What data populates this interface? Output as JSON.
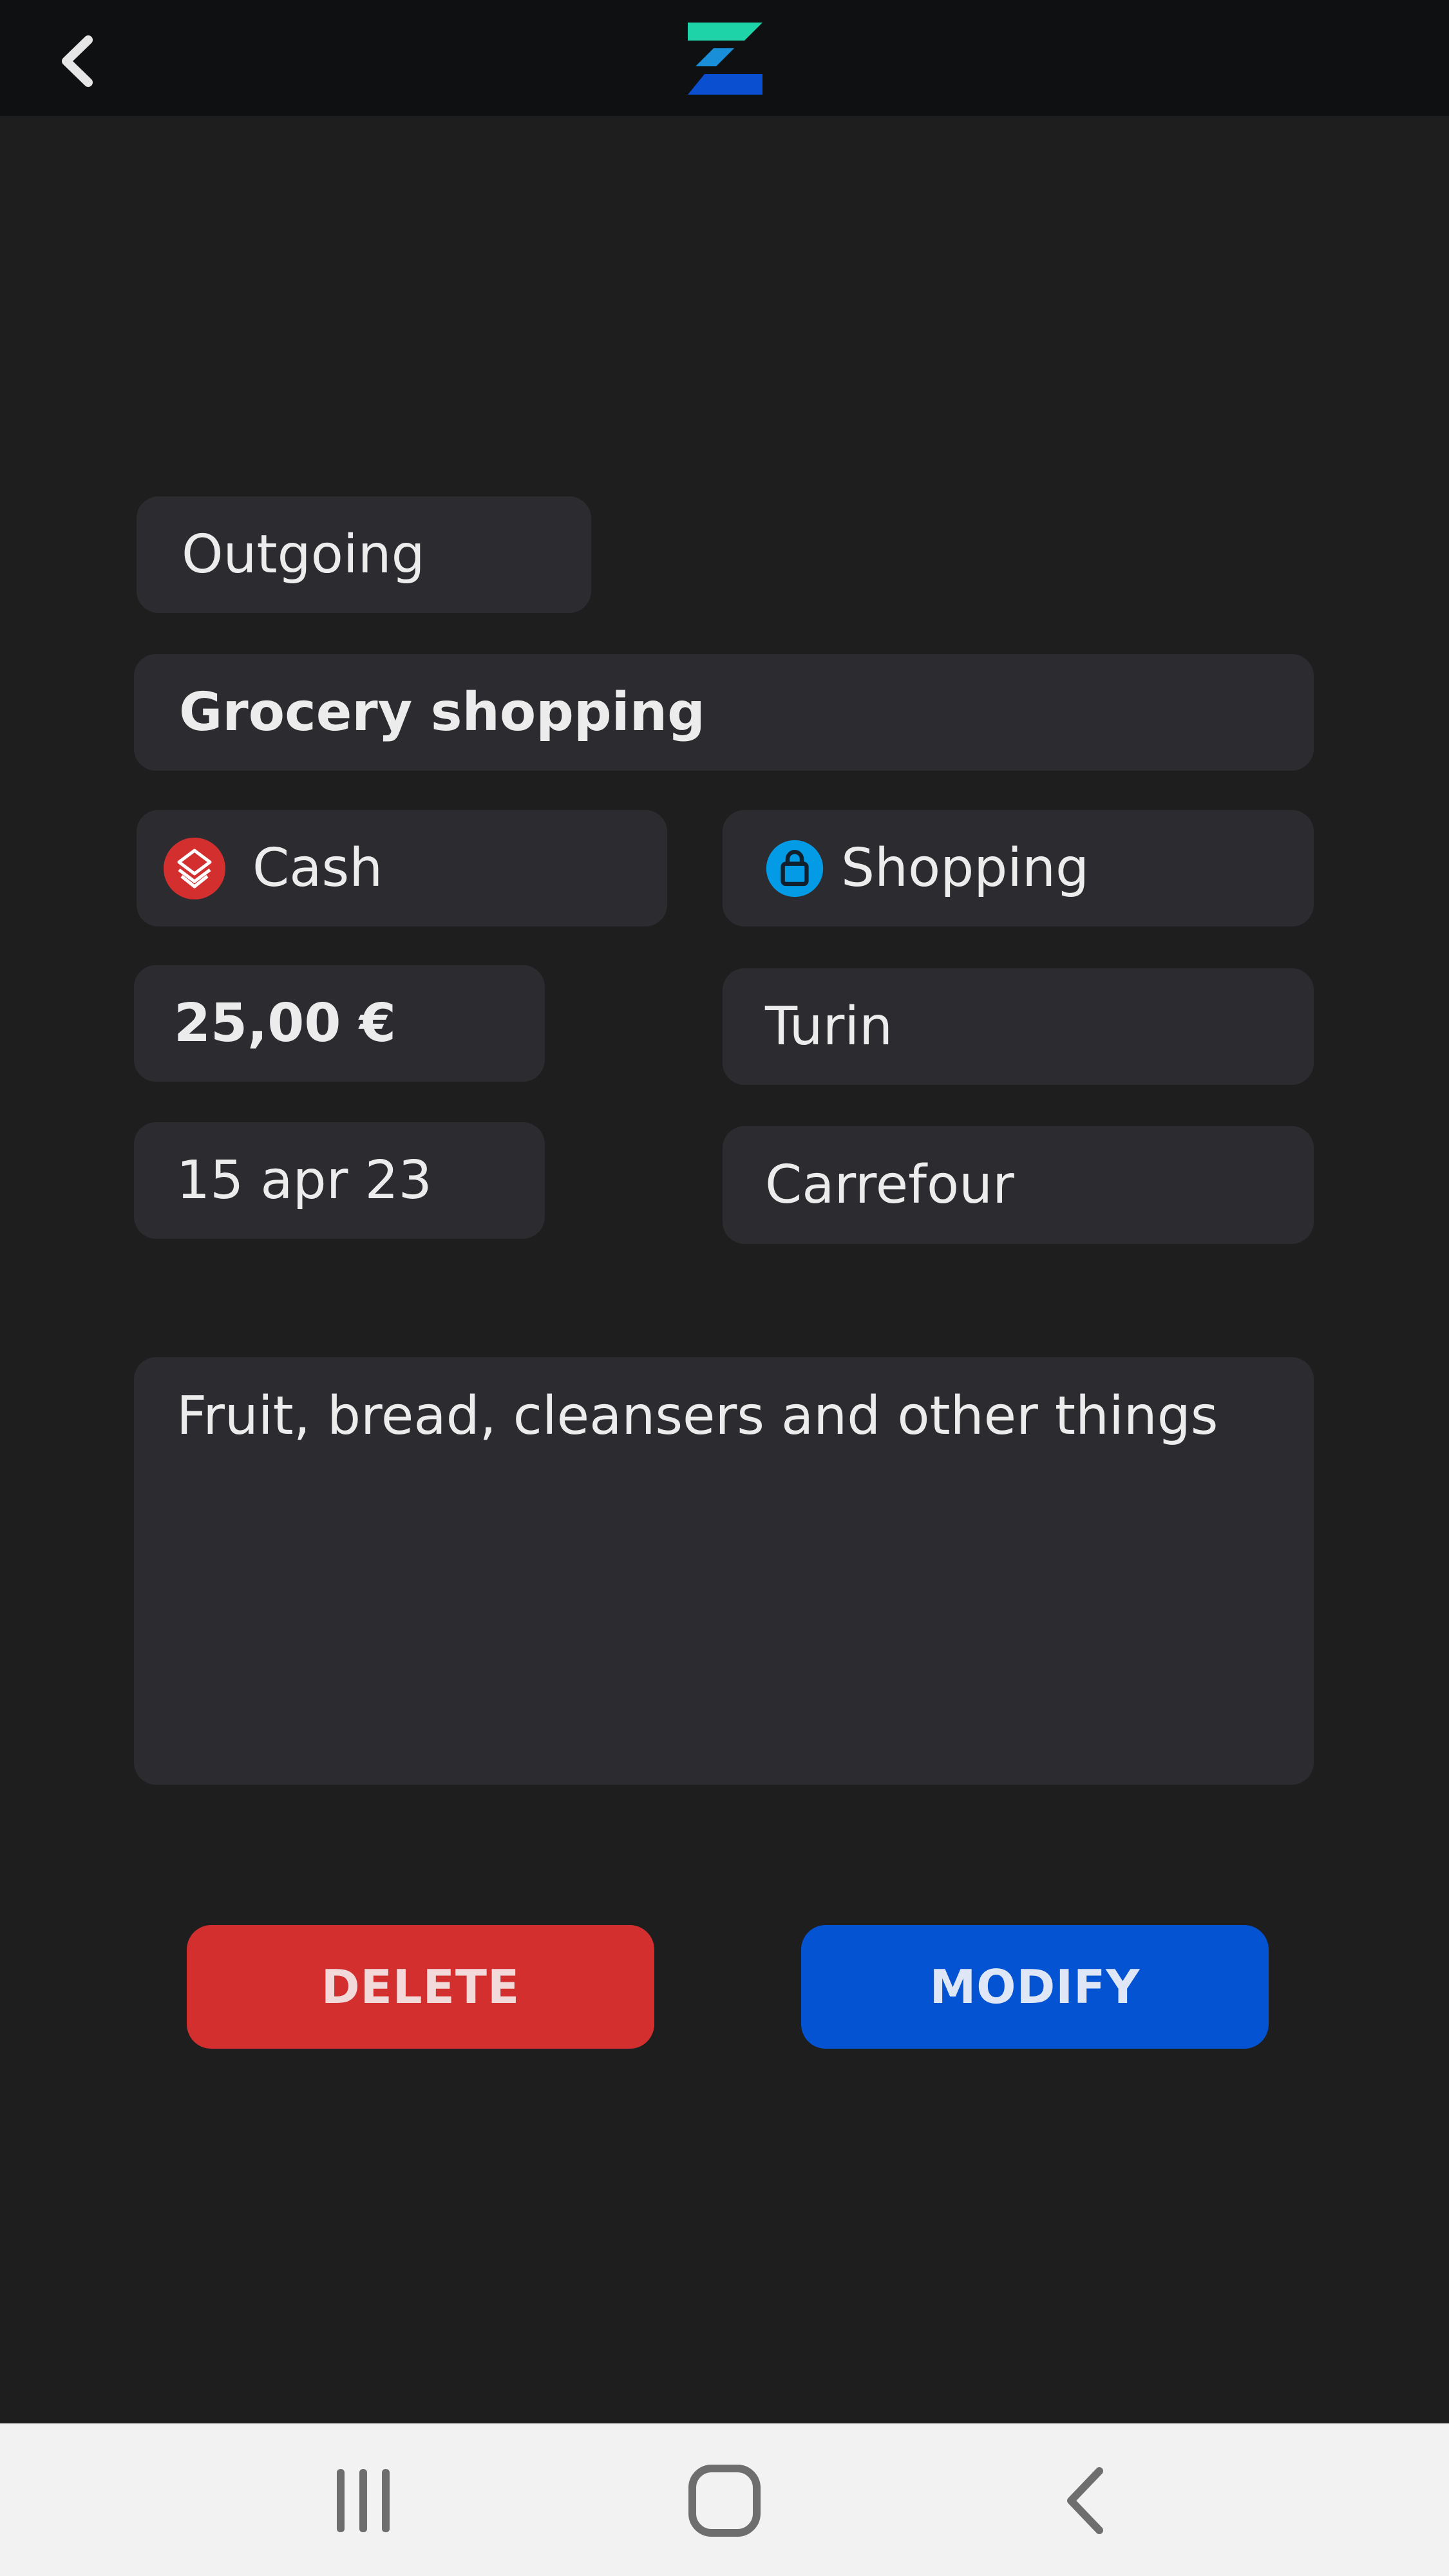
{
  "header": {
    "back_icon": "chevron-left-icon",
    "logo_icon": "app-logo-icon",
    "colors": {
      "logo_top": "#1ed3a7",
      "logo_mid": "#1a8fd9",
      "logo_bottom": "#0a4fd0"
    }
  },
  "transaction": {
    "type": "Outgoing",
    "title": "Grocery shopping",
    "wallet": {
      "label": "Cash",
      "icon": "cash-icon",
      "color": "#d32f2f"
    },
    "category": {
      "label": "Shopping",
      "icon": "shopping-bag-icon",
      "color": "#039be5"
    },
    "amount": "25,00 €",
    "city": "Turin",
    "date": "15 apr 23",
    "store": "Carrefour",
    "notes": "Fruit, bread, cleansers and other things"
  },
  "actions": {
    "delete_label": "DELETE",
    "delete_color": "#d32f2f",
    "modify_label": "MODIFY",
    "modify_color": "#0353d3"
  },
  "system_nav": {
    "recents_icon": "recent-apps-icon",
    "home_icon": "home-icon",
    "back_icon": "back-icon"
  }
}
